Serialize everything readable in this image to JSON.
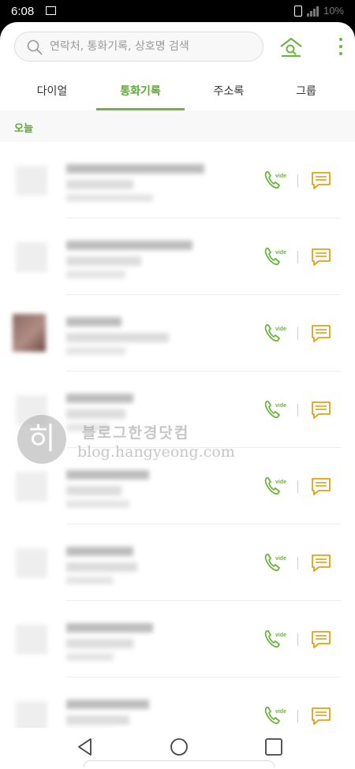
{
  "status_bar": {
    "time": "6:08",
    "battery": "10%"
  },
  "search": {
    "placeholder": "연락처, 통화기록, 상호명 검색"
  },
  "tabs": [
    {
      "label": "다이얼",
      "active": false
    },
    {
      "label": "통화기록",
      "active": true
    },
    {
      "label": "주소록",
      "active": false
    },
    {
      "label": "그룹",
      "active": false
    }
  ],
  "section": {
    "title": "오늘"
  },
  "call_log": {
    "entries_count_visible": 8,
    "call_button_label": "video",
    "name_blurred": true
  },
  "watermark": {
    "title": "블로그한경닷컴",
    "url": "blog.hangyeong.com",
    "logo_char": "히"
  },
  "colors": {
    "accent": "#6cb33f",
    "message_icon": "#e0a116",
    "text": "#333333"
  },
  "nav_bar": {
    "back": "back-icon",
    "home": "home-icon",
    "recents": "recents-icon"
  }
}
